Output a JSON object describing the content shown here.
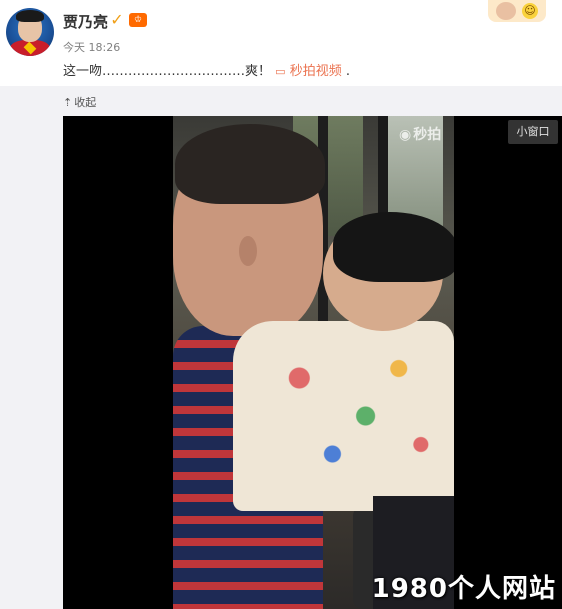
{
  "post": {
    "username": "贾乃亮",
    "verified_icon": "verified-badge-icon",
    "vip_icon": "vip-crown-icon",
    "timestamp": "今天 18:26",
    "text_before": "这一吻……………………………爽！",
    "video_link_label": "秒拍视频",
    "text_after": " .",
    "link_color": "#eb7350"
  },
  "actions": {
    "collapse_label": "收起",
    "collapse_icon": "arrow-up-icon"
  },
  "video": {
    "brand_label": "秒拍",
    "brand_icon": "miaopai-eye-icon",
    "mini_window_label": "小窗口"
  },
  "watermark": {
    "text": "1980个人网站"
  }
}
